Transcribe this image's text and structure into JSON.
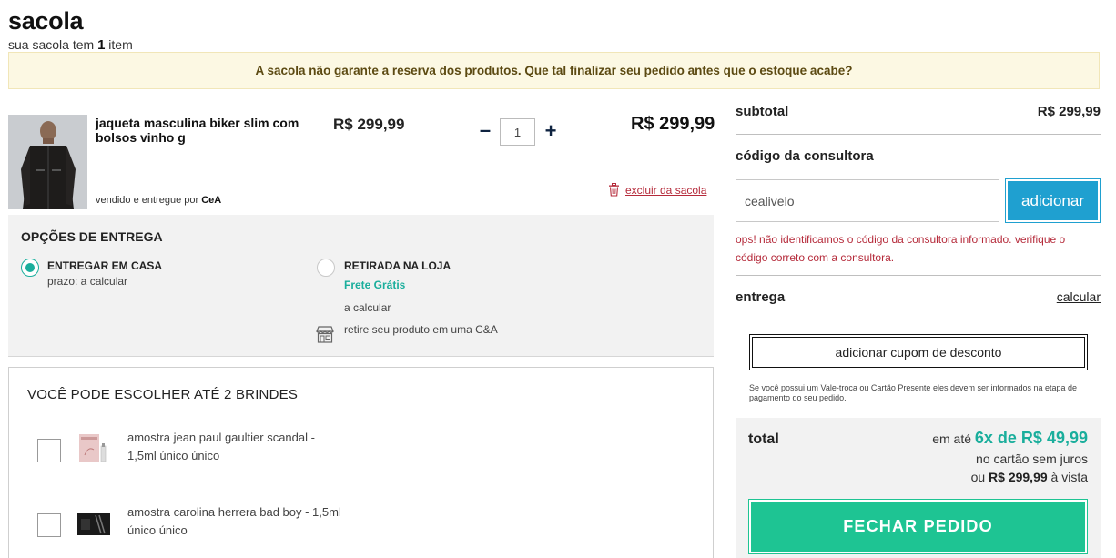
{
  "header": {
    "title": "sacola",
    "subtitle_prefix": "sua sacola tem",
    "item_count": "1",
    "subtitle_suffix": "item"
  },
  "banner": {
    "text": "A sacola não garante a reserva dos produtos. Que tal finalizar seu pedido antes que o estoque acabe?"
  },
  "product": {
    "name": "jaqueta masculina biker slim com bolsos vinho g",
    "seller_prefix": "vendido e entregue por",
    "seller": "CeA",
    "unit_price": "R$ 299,99",
    "quantity": "1",
    "minus": "–",
    "plus": "+",
    "total_price": "R$ 299,99",
    "remove_label": "excluir da sacola"
  },
  "delivery": {
    "title": "OPÇÕES DE ENTREGA",
    "home": {
      "label": "ENTREGAR EM CASA",
      "sub": "prazo: a calcular",
      "selected": true
    },
    "pickup": {
      "label": "RETIRADA NA LOJA",
      "free": "Frete Grátis",
      "sub": "a calcular",
      "store_note": "retire seu produto em uma C&A",
      "selected": false
    }
  },
  "gifts": {
    "title": "VOCÊ PODE ESCOLHER ATÉ 2 BRINDES",
    "items": [
      {
        "name": "amostra jean paul gaultier scandal - 1,5ml único único",
        "checked": false
      },
      {
        "name": "amostra carolina herrera bad boy - 1,5ml único único",
        "checked": false
      }
    ]
  },
  "summary": {
    "subtotal_label": "subtotal",
    "subtotal_value": "R$ 299,99",
    "consultant_label": "código da consultora",
    "consultant_value": "cealivelo",
    "consultant_button": "adicionar",
    "consultant_error": "ops! não identificamos o código da consultora informado. verifique o código correto com a consultora.",
    "shipping_label": "entrega",
    "shipping_link": "calcular",
    "coupon_button": "adicionar cupom de desconto",
    "coupon_note": "Se você possui um Vale-troca ou Cartão Presente eles devem ser informados na etapa de pagamento do seu pedido.",
    "total_label": "total",
    "installment_prefix": "em até",
    "installment_value": "6x de R$ 49,99",
    "installment_note": "no cartão sem juros",
    "cash_prefix": "ou",
    "cash_value": "R$ 299,99",
    "cash_suffix": "à vista",
    "checkout_button": "FECHAR PEDIDO"
  },
  "colors": {
    "accent_green": "#1ec493",
    "teal": "#1aae9c",
    "blue_button": "#1fa0d0",
    "error_red": "#b52a3a",
    "banner_bg": "#fcf8e3"
  }
}
